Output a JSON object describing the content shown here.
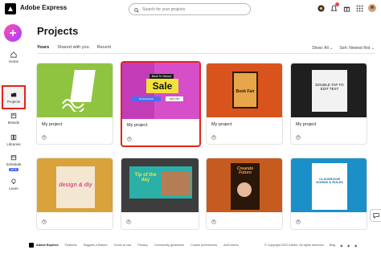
{
  "app": {
    "brand": "Adobe Express"
  },
  "search": {
    "placeholder": "Search for your projects"
  },
  "rail": {
    "items": [
      {
        "label": "Home"
      },
      {
        "label": "Projects"
      },
      {
        "label": "Brands"
      },
      {
        "label": "Libraries"
      },
      {
        "label": "Schedule",
        "badge": "NEW"
      },
      {
        "label": "Learn"
      }
    ]
  },
  "main": {
    "title": "Projects",
    "tabs": [
      {
        "label": "Yours"
      },
      {
        "label": "Shared with you"
      },
      {
        "label": "Recent"
      }
    ],
    "show_filter": "Show: All",
    "sort_filter": "Sort: Newest first"
  },
  "cards": [
    {
      "name": "My project"
    },
    {
      "name": "My project",
      "thumb_text": {
        "top": "Back To School",
        "main": "Sale",
        "bottom_left": "Backstudents",
        "bottom_right": "20% OFF"
      }
    },
    {
      "name": "My project",
      "thumb_text": {
        "main": "Book Fair"
      }
    },
    {
      "name": "My project",
      "thumb_text": {
        "main": "DOUBLE TAP TO EDIT TEXT"
      }
    },
    {
      "name": "",
      "thumb_text": {
        "main": "design & diy"
      }
    },
    {
      "name": "",
      "thumb_text": {
        "main": "Tip of the day"
      }
    },
    {
      "name": "",
      "thumb_text": {
        "main": "Creando Futuro"
      }
    },
    {
      "name": "",
      "thumb_text": {
        "main": "CLASSROOM NORMS & RULES"
      }
    }
  ],
  "footer": {
    "brand": "Adobe Express",
    "links": [
      "Features",
      "Suggest a feature",
      "Terms of use",
      "Privacy",
      "Community guidelines",
      "Cookie preferences",
      "AdChoices"
    ],
    "copyright": "© Copyright 2022 Adobe. All rights reserved.",
    "blog": "Blog"
  },
  "colors": {
    "accent": "#e3241b",
    "create_gradient_start": "#ff4fb0",
    "create_gradient_end": "#a83dff"
  }
}
